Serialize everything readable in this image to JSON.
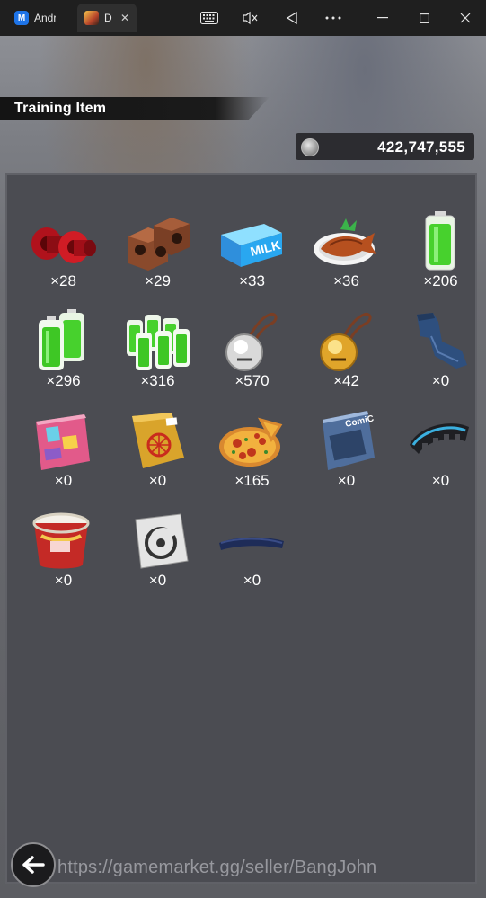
{
  "window": {
    "tabs": [
      {
        "label": "Andr",
        "icon": "app-logo-icon",
        "active": false
      },
      {
        "label": "D",
        "icon": "game-logo-icon",
        "active": true
      }
    ],
    "close_label": "✕",
    "controls": [
      "keyboard-icon",
      "mute-icon",
      "back-triangle-icon",
      "more-icon",
      "minimize-icon",
      "maximize-icon",
      "close-icon"
    ]
  },
  "header": {
    "title": "Training Item"
  },
  "currency": {
    "icon": "zeni-coin-icon",
    "value": "422,747,555"
  },
  "items": [
    {
      "name": "red-weights",
      "count": "×28"
    },
    {
      "name": "brick-weights",
      "count": "×29"
    },
    {
      "name": "milk-carton",
      "count": "×33"
    },
    {
      "name": "fish-plate",
      "count": "×36"
    },
    {
      "name": "battery-single",
      "count": "×206"
    },
    {
      "name": "battery-double",
      "count": "×296"
    },
    {
      "name": "battery-pack",
      "count": "×316"
    },
    {
      "name": "silver-bell-charm",
      "count": "×570"
    },
    {
      "name": "gold-bell-charm",
      "count": "×42"
    },
    {
      "name": "jeans",
      "count": "×0"
    },
    {
      "name": "pink-book",
      "count": "×0"
    },
    {
      "name": "yellow-magazine",
      "count": "×0"
    },
    {
      "name": "pizza",
      "count": "×165"
    },
    {
      "name": "comic-book",
      "count": "×0"
    },
    {
      "name": "spiked-bracelet",
      "count": "×0"
    },
    {
      "name": "ramen-cup",
      "count": "×0"
    },
    {
      "name": "symbol-card",
      "count": "×0"
    },
    {
      "name": "navy-wristband",
      "count": "×0"
    }
  ],
  "back_button": {
    "icon": "back-arrow-icon"
  },
  "watermark": "https://gamemarket.gg/seller/BangJohn"
}
